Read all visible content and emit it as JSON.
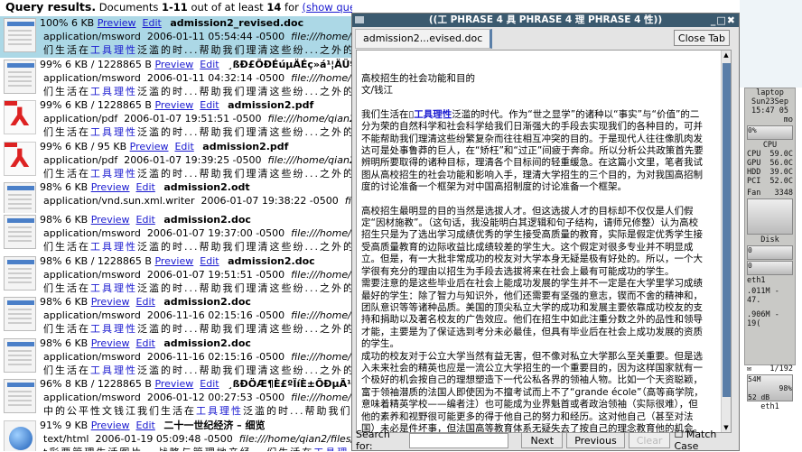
{
  "header": {
    "title": "Query results.",
    "prefix": "Documents",
    "range": "1-11",
    "middle": "out of at least",
    "count": "14",
    "for": "for",
    "show_query": "(show query)"
  },
  "common": {
    "preview": "Preview",
    "edit": "Edit"
  },
  "results": [
    {
      "icon": "doc",
      "meta": "100% 6 KB",
      "name": "admission2_revised.doc",
      "mime": "application/msword",
      "date": "2006-01-11 05:54:44 -0500",
      "url": "file:///home/qian2/",
      "snip_a": "们生活在",
      "snip_h": "工具理性",
      "snip_b": "泛滥的时...帮助我们理清这些纷...之外的",
      "selected": true
    },
    {
      "icon": "doc",
      "meta": "99% 6 KB / 1228865 B",
      "name": "¸ßÐ£ÕÐÉúµÄÉç»á¹¦ÄÜºÍÄ¿",
      "mime": "application/msword",
      "date": "2006-01-11 04:32:14 -0500",
      "url": "file:///home/qian2/",
      "snip_a": "们生活在",
      "snip_h": "工具理性",
      "snip_b": "泛滥的时...帮助我们理清这些纷...之外的"
    },
    {
      "icon": "pdf",
      "meta": "99% 6 KB / 1228865 B",
      "name": "admission2.pdf",
      "mime": "application/pdf",
      "date": "2006-01-07 19:51:51 -0500",
      "url": "file:///home/qian2/m",
      "snip_a": "们生活在",
      "snip_h": "工具理性",
      "snip_b": "泛滥的时...帮助我们理清这些纷...之外的"
    },
    {
      "icon": "pdf",
      "meta": "99% 6 KB / 95 KB",
      "name": "admission2.pdf",
      "mime": "application/pdf",
      "date": "2006-01-07 19:39:25 -0500",
      "url": "file:///home/qian2/fi",
      "snip_a": "们生活在",
      "snip_h": "工具理性",
      "snip_b": "泛滥的时...帮助我们理清这些纷...之外的"
    },
    {
      "icon": "doc",
      "meta": "98% 6 KB",
      "name": "admission2.odt",
      "mime": "application/vnd.sun.xml.writer",
      "date": "2006-01-07 19:38:22 -0500",
      "url": "file:/",
      "short": true
    },
    {
      "icon": "doc",
      "meta": "98% 6 KB",
      "name": "admission2.doc",
      "mime": "application/msword",
      "date": "2006-01-07 19:37:00 -0500",
      "url": "file:///home/qia",
      "snip_a": "们生活在",
      "snip_h": "工具理性",
      "snip_b": "泛滥的时...帮助我们理清这些纷...之外的"
    },
    {
      "icon": "doc",
      "meta": "98% 6 KB / 1228865 B",
      "name": "admission2.doc",
      "mime": "application/msword",
      "date": "2006-01-07 19:51:51 -0500",
      "url": "file:///home/qia",
      "snip_a": "们生活在",
      "snip_h": "工具理性",
      "snip_b": "泛滥的时...帮助我们理清这些纷...之外的"
    },
    {
      "icon": "doc",
      "meta": "98% 6 KB",
      "name": "admission2.doc",
      "mime": "application/msword",
      "date": "2006-11-16 02:15:16 -0500",
      "url": "file:///home/qia",
      "snip_a": "们生活在",
      "snip_h": "工具理性",
      "snip_b": "泛滥的时...帮助我们理清这些纷...之外的"
    },
    {
      "icon": "doc",
      "meta": "98% 6 KB",
      "name": "admission2.doc",
      "mime": "application/msword",
      "date": "2006-11-16 02:15:16 -0500",
      "url": "file:///home/qia",
      "snip_a": "们生活在",
      "snip_h": "工具理性",
      "snip_b": "泛滥的时...帮助我们理清这些纷...之外的"
    },
    {
      "icon": "doc",
      "meta": "96% 8 KB / 1228865 B",
      "name": "¸ßÐÖÆ¶È£ºÏíÈ±ÕÐµÄ¹«Â",
      "mime": "application/msword",
      "date": "2006-01-12 00:27:53 -0500",
      "url": "file:///home/qia",
      "snip_a": "中的公平性文钱江我们生活在",
      "snip_h": "工具理性",
      "snip_b": "泛滥的时...帮助我们"
    },
    {
      "icon": "html",
      "meta": "91% 9 KB",
      "name": "二十一世纪经济 – 细览",
      "mime": "text/html",
      "date": "2006-01-19 05:09:48 -0500",
      "url": "file:///home/qian2/files/co",
      "snip_a": "t彩票管理生活图片...战略与管理地产经...们生活在",
      "snip_h": "工具理",
      "snip_b": ""
    }
  ],
  "dialog": {
    "title": "((工 PHRASE 4 具 PHRASE 4 理 PHRASE 4 性))",
    "window_controls": "_□✖",
    "tab": "admission2...evised.doc",
    "close_tab": "Close Tab",
    "doc_title": "高校招生的社会功能和目的",
    "doc_author": "文/钱江",
    "p1_a": "我们生活在▯",
    "p1_h": "工具理性",
    "p1_b": "泛滥的时代。作为“世之显学”的诸种以“事实”与“价值”的二分为荣的自然科学和社会科学给我们日渐强大的手段去实现我们的各种目的，可并不能帮助我们理清这些纷繁复杂而往往相互冲突的目的。于是现代人往往像肌肉发达可是处事鲁莽的巨人，在“矫枉”和“过正”间疲于奔命。所以分析公共政策首先要辨明所要取得的诸种目标，理清各个目标间的轻重缓急。在这篇小文里，笔者我试图从高校招生的社会功能和影响入手，理清大学招生的三个目的，为对我国高招制度的讨论准备一个框架为对中国高招制度的讨论准备一个框架。",
    "p2": "高校招生最明显的目的当然是选拔人才。但这选拔人才的目标却不仅仅是人们假定“因材施教”。（这句话，我没能明白其逻辑和句子结构，请师兄修整）认为高校招生只是为了选出学习成绩优秀的学生接受高质量的教育，实际是假定优秀学生接受高质量教育的边际收益比成绩较差的学生大。这个假定对很多专业并不明显成立。但是，有一大批非常成功的校友对大学本身无疑是极有好处的。所以，一个大学很有充分的理由以招生为手段去选拔将来在社会上最有可能成功的学生。",
    "p3": "需要注意的是这些毕业后在社会上能成功发展的学生并不一定是在大学里学习成绩最好的学生：除了智力与知识外，他们还需要有坚强的意志，锲而不舍的精神和，团队意识等等诸种品质。美国的顶尖私立大学的成功和发展主要依靠成功校友的支持和捐助以及著名校友的广告效应。他们在招生中如此注重分数之外的品性和领导才能，主要是为了保证选到考分未必最佳，但具有毕业后在社会上成功发展的资质的学生。",
    "p4": "成功的校友对于公立大学当然有益无害，但不像对私立大学那么至关重要。但是选入未来社会的精英也应是一流公立大学招生的一个重要目的，因为这样国家就有一个极好的机会按自己的理想塑造下一代公私各界的领袖人物。比如一个天资聪颖，富于领袖潜质的法国人即使因为不擅考试而上不了“grande école”（高等商学院，意味着精英学校——编者注）也可能成为业界魁首或者政治领袖（实际很难），但他的素养和视野很可能更多的得于他自己的努力和经历。这对他自己（甚至对法国）未必是件坏事，但法国高等教育体系无疑失去了按自己的理念教育他的机会。无论是选拔成功校友还是选拔未来领袖，招生目的都不仅仅是选出在大学里成绩优",
    "search_label": "Search for:",
    "search_value": "",
    "next": "Next",
    "previous": "Previous",
    "clear": "Clear",
    "match_case": "Match Case"
  },
  "gkrellm": {
    "host": "laptop",
    "date": "Sun23Sep",
    "time": "15:47 05",
    "mo": "mo",
    "cpu_pct": "0%",
    "cpu_label": "CPU",
    "temps": [
      {
        "k": "CPU",
        "v": "59.0C"
      },
      {
        "k": "GPU",
        "v": "56.0C"
      },
      {
        "k": "HDD",
        "v": "39.0C"
      },
      {
        "k": "PCI",
        "v": "52.0C"
      }
    ],
    "fan_label": "Fan",
    "fan_value": "3348",
    "disk_label": "Disk",
    "disk_a": "0",
    "disk_b": "0",
    "net": "eth1",
    "net_in": ".011M - 47.",
    "net_out": ".906M - 19(",
    "mail": "1/192",
    "mem": "54M",
    "batt": "98%",
    "signal": "52 dB",
    "wifi": "eth1"
  },
  "colors": {
    "selected_row": "#acd8e6",
    "link": "#1a1ad0",
    "titlebar": "#3b5a6f"
  }
}
